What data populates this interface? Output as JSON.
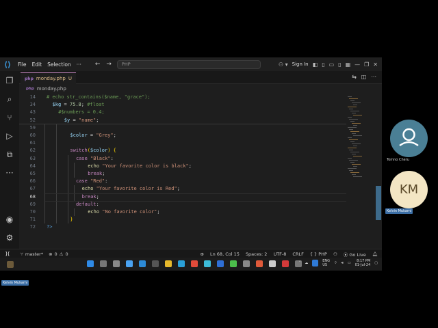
{
  "window": {
    "menu": [
      "File",
      "Edit",
      "Selection"
    ],
    "search_placeholder": "PHP",
    "sign_in": "Sign In"
  },
  "tab": {
    "icon_text": "php",
    "filename": "monday.php",
    "status": "U"
  },
  "breadcrumb": {
    "icon_text": "php",
    "filename": "monday.php"
  },
  "code_lines": [
    {
      "n": "14",
      "html": "<span class='c-com'># echo str_contains($name, \"grace\");</span>",
      "indent": 0
    },
    {
      "n": "34",
      "html": "<span class='c-var'>$kg</span><span class='c-pun'> = </span><span class='c-num'>75.8</span><span class='c-pun'>; </span><span class='c-com'>#float</span>",
      "indent": 1
    },
    {
      "n": "43",
      "html": "<span class='c-com'>#$numbers = 0.4;</span>",
      "indent": 2
    },
    {
      "n": "52",
      "html": "<span class='c-var'>$y</span><span class='c-pun'> = </span><span class='c-str'>\"name\"</span><span class='c-pun'>;</span>",
      "indent": 3
    },
    {
      "n": "59",
      "html": "",
      "indent": 0
    },
    {
      "n": "60",
      "html": "<span class='c-var'>$color</span><span class='c-pun'> = </span><span class='c-str'>\"Grey\"</span><span class='c-pun'>;</span>",
      "indent": 4
    },
    {
      "n": "61",
      "html": "",
      "indent": 0
    },
    {
      "n": "62",
      "html": "<span class='c-kw'>switch</span><span class='c-br'>(</span><span class='c-var'>$color</span><span class='c-br'>)</span><span class='c-pun'> </span><span class='c-br'>{</span>",
      "indent": 4
    },
    {
      "n": "63",
      "html": "<span class='c-kw'>case</span><span class='c-pun'> </span><span class='c-str'>\"Black\"</span><span class='c-pun'>:</span>",
      "indent": 5
    },
    {
      "n": "64",
      "html": "<span class='c-fn'>echo</span><span class='c-pun'> </span><span class='c-str'>\"Your favorite color is black\"</span><span class='c-pun'>;</span>",
      "indent": 7
    },
    {
      "n": "65",
      "html": "<span class='c-kw'>break</span><span class='c-pun'>;</span>",
      "indent": 7
    },
    {
      "n": "66",
      "html": "<span class='c-kw'>case</span><span class='c-pun'> </span><span class='c-str'>\"Red\"</span><span class='c-pun'>:</span>",
      "indent": 5
    },
    {
      "n": "67",
      "html": "<span class='c-fn'>echo</span><span class='c-pun'> </span><span class='c-str'>\"Your favorite color is Red\"</span><span class='c-pun'>;</span>",
      "indent": 6
    },
    {
      "n": "68",
      "html": "<span class='c-kw'>break</span><span class='c-pun'>;</span>",
      "indent": 6
    },
    {
      "n": "69",
      "html": "<span class='c-kw'>default</span><span class='c-pun'>:</span>",
      "indent": 5
    },
    {
      "n": "70",
      "html": "<span class='c-fn'>echo</span><span class='c-pun'> </span><span class='c-str'>\"No favorite color\"</span><span class='c-pun'>;</span>",
      "indent": 7
    },
    {
      "n": "71",
      "html": "<span class='c-br'>}</span>",
      "indent": 4
    },
    {
      "n": "72",
      "html": "<span class='c-tag'>?&gt;</span>",
      "indent": 0
    }
  ],
  "current_line": "68",
  "status": {
    "branch": "master*",
    "errors": "0",
    "warnings": "0",
    "position": "Ln 68, Col 15",
    "spaces": "Spaces: 2",
    "encoding": "UTF-8",
    "eol": "CRLF",
    "language": "PHP",
    "go_live": "Go Live"
  },
  "taskbar": {
    "lang": "ENG",
    "region": "US",
    "time": "8:17 PM",
    "date": "01-Jul-24"
  },
  "participants": [
    {
      "name": "Tomno Cheru",
      "initials": ""
    },
    {
      "name": "Kelvin Mukami",
      "initials": "KM"
    }
  ],
  "speaker_tag": "Kelvin Mukami",
  "colors": {
    "accent": "#3b9ae1",
    "tab_border": "#c586c0",
    "status_bg": "#181818"
  }
}
